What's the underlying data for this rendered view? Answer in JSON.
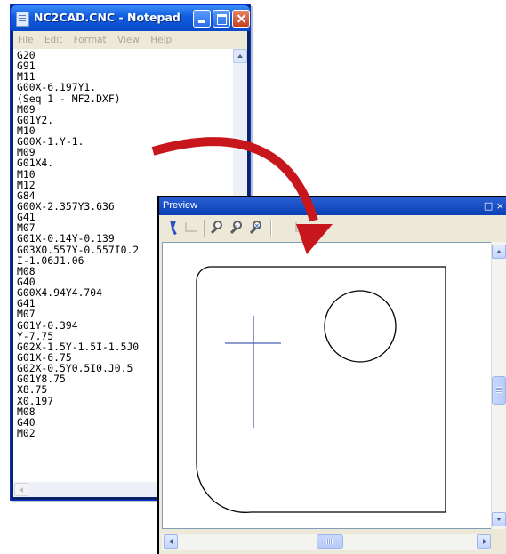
{
  "notepad": {
    "title": "NC2CAD.CNC - Notepad",
    "menu": [
      "File",
      "Edit",
      "Format",
      "View",
      "Help"
    ],
    "lines": [
      "G20",
      "G91",
      "M11",
      "G00X-6.197Y1.",
      "(Seq 1 - MF2.DXF)",
      "M09",
      "G01Y2.",
      "M10",
      "G00X-1.Y-1.",
      "M09",
      "G01X4.",
      "M10",
      "M12",
      "G84",
      "G00X-2.357Y3.636",
      "G41",
      "M07",
      "G01X-0.14Y-0.139",
      "G03X0.557Y-0.557I0.2",
      "I-1.06J1.06",
      "M08",
      "G40",
      "G00X4.94Y4.704",
      "G41",
      "M07",
      "G01Y-0.394",
      "Y-7.75",
      "G02X-1.5Y-1.5I-1.5J0",
      "G01X-6.75",
      "G02X-0.5Y0.5I0.J0.5",
      "G01Y8.75",
      "X8.75",
      "X0.197",
      "M08",
      "G40",
      "M02"
    ]
  },
  "preview": {
    "title": "Preview",
    "close_glyph": "□ ×",
    "toolbar_icons": [
      "select-arrow-icon",
      "layer-icon",
      "zoom-window-icon",
      "zoom-out-icon",
      "zoom-extents-icon",
      "rotate-icon",
      "measure-icon"
    ]
  },
  "colors": {
    "arrow": "#c8161d",
    "part_outline": "#000000",
    "crosshair": "#4a5fb0"
  }
}
